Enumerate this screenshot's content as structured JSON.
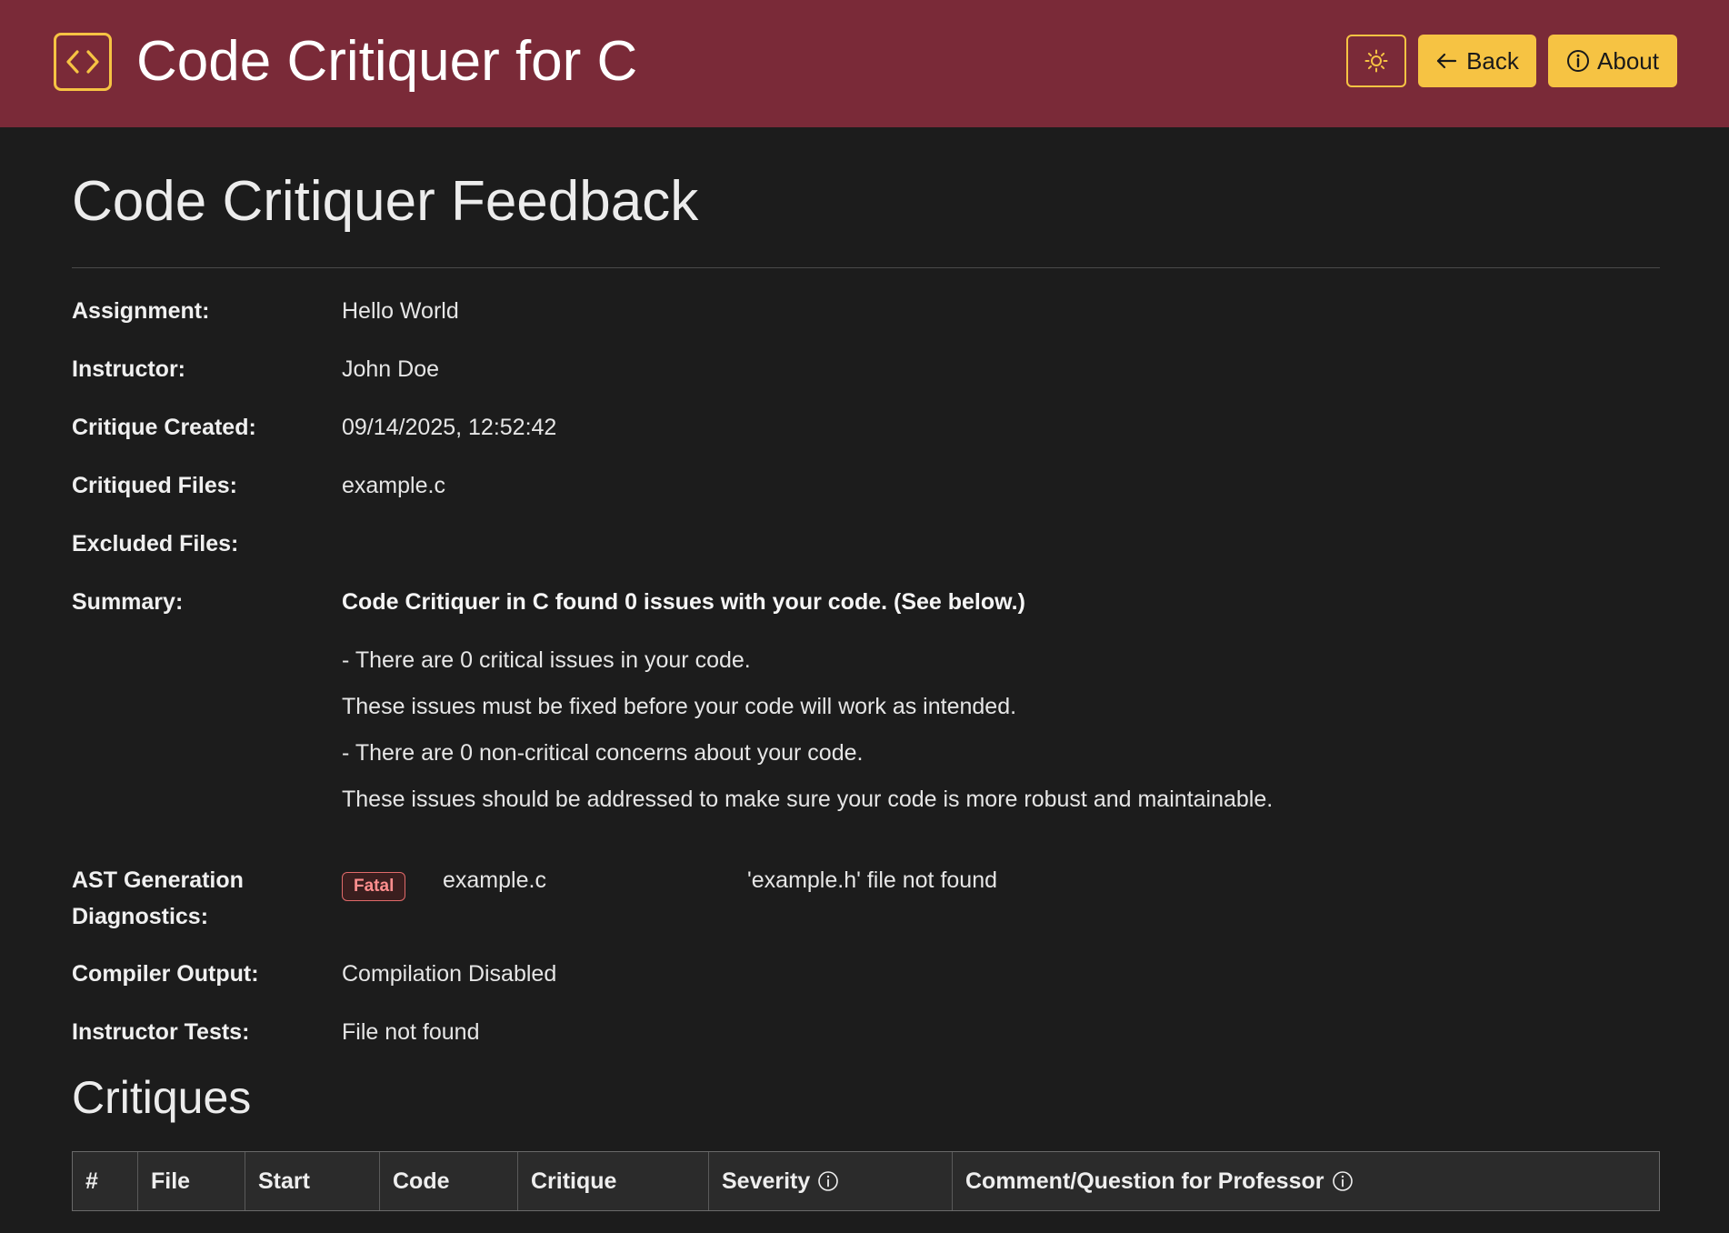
{
  "header": {
    "app_title": "Code Critiquer for C",
    "logo_icon": "code-brackets-icon",
    "theme_icon": "sun-icon",
    "back_label": "Back",
    "back_icon": "arrow-left-icon",
    "about_label": "About",
    "about_icon": "info-circle-icon",
    "colors": {
      "header_bg": "#7a2a38",
      "accent": "#f6c343",
      "page_bg": "#1c1c1c"
    }
  },
  "page": {
    "title": "Code Critiquer Feedback"
  },
  "details": {
    "assignment_label": "Assignment:",
    "assignment_value": "Hello World",
    "instructor_label": "Instructor:",
    "instructor_value": "John Doe",
    "created_label": "Critique Created:",
    "created_value": "09/14/2025, 12:52:42",
    "critiqued_files_label": "Critiqued Files:",
    "critiqued_files_value": "example.c",
    "excluded_files_label": "Excluded Files:",
    "excluded_files_value": "",
    "summary_label": "Summary:",
    "summary_headline": "Code Critiquer in C found 0 issues with your code. (See below.)",
    "summary_lines": [
      "- There are 0 critical issues in your code.",
      "These issues must be fixed before your code will work as intended.",
      "- There are 0 non-critical concerns about your code.",
      "These issues should be addressed to make sure your code is more robust and maintainable."
    ],
    "ast_label_line1": "AST Generation",
    "ast_label_line2": "Diagnostics:",
    "ast_badge": "Fatal",
    "ast_file": "example.c",
    "ast_message": "'example.h' file not found",
    "compiler_label": "Compiler Output:",
    "compiler_value": "Compilation Disabled",
    "tests_label": "Instructor Tests:",
    "tests_value": "File not found"
  },
  "critiques": {
    "title": "Critiques",
    "columns": [
      "#",
      "File",
      "Start",
      "Code",
      "Critique",
      "Severity",
      "Comment/Question for Professor"
    ],
    "rows": []
  }
}
